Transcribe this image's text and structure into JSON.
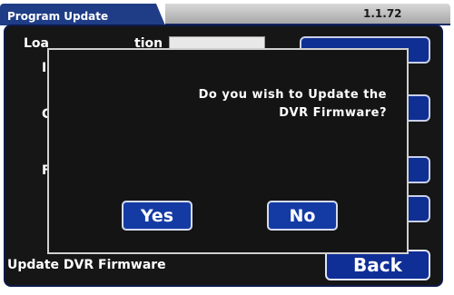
{
  "window": {
    "title": "Program Update",
    "version": "1.1.72"
  },
  "background": {
    "row1_label_partial": "Loa",
    "row1_label_partial_end": "tion",
    "row2_partial": "I",
    "row3_partial": "C",
    "row4_partial": "F",
    "status_label": "Update DVR Firmware",
    "back_label": "Back"
  },
  "dialog": {
    "message_line1": "Do you wish to Update the",
    "message_line2": "DVR Firmware?",
    "yes_label": "Yes",
    "no_label": "No"
  },
  "colors": {
    "title_tab": "#1f3d86",
    "button_blue": "#143aa4",
    "panel_bg": "#161616"
  }
}
